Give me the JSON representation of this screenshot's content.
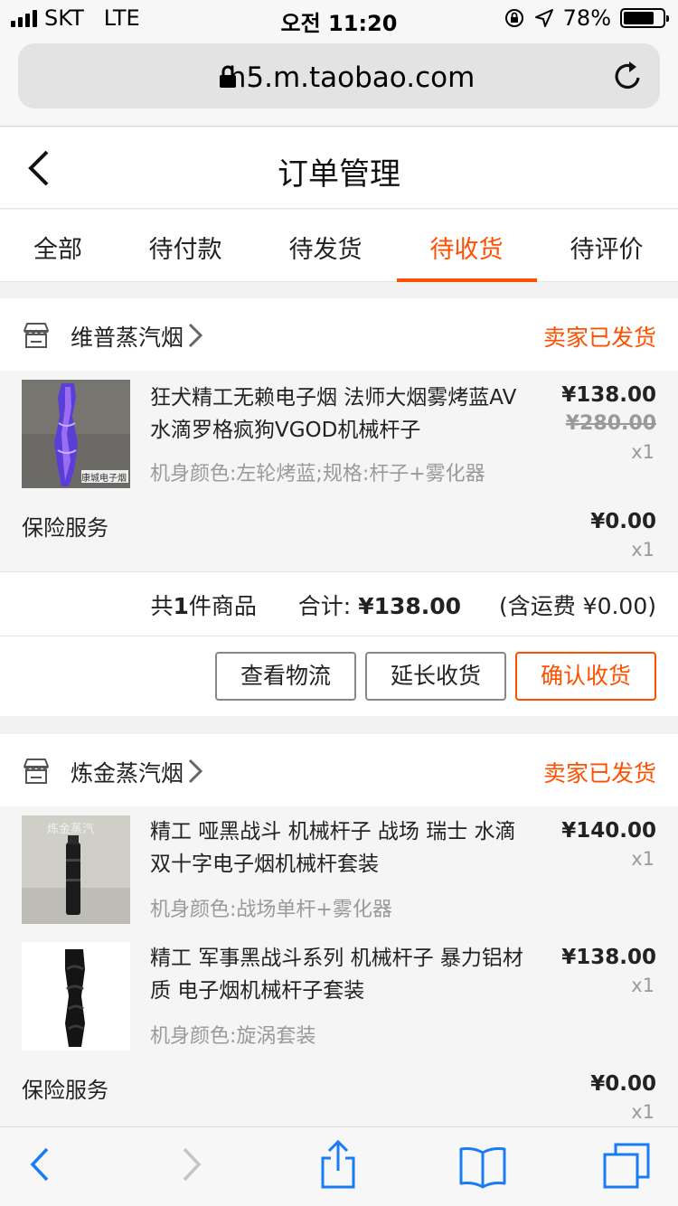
{
  "status_bar": {
    "carrier": "SKT",
    "network": "LTE",
    "time": "오전 11:20",
    "battery": "78%",
    "battery_level": 0.78
  },
  "browser": {
    "url": "h5.m.taobao.com"
  },
  "header": {
    "title": "订单管理"
  },
  "tabs": [
    {
      "label": "全部"
    },
    {
      "label": "待付款"
    },
    {
      "label": "待发货"
    },
    {
      "label": "待收货"
    },
    {
      "label": "待评价"
    }
  ],
  "active_tab": "待收货",
  "accent_color": "#ff5000",
  "orders": [
    {
      "shop": "维普蒸汽烟",
      "status": "卖家已发货",
      "items": [
        {
          "name": "狂犬精工无赖电子烟 法师大烟雾烤蓝AV水滴罗格疯狗VGOD机械杆子",
          "sku": "机身颜色:左轮烤蓝;规格:杆子+雾化器",
          "price": "¥138.00",
          "original_price": "¥280.00",
          "qty": "x1",
          "thumb_caption": "康城电子烟"
        }
      ],
      "insurance": {
        "label": "保险服务",
        "price": "¥0.00",
        "qty": "x1"
      },
      "summary": {
        "count_prefix": "共",
        "count": "1",
        "count_suffix": "件商品",
        "total_label": "合计:",
        "total": "¥138.00",
        "shipping": "(含运费 ¥0.00)"
      },
      "actions": [
        "查看物流",
        "延长收货",
        "确认收货"
      ]
    },
    {
      "shop": "炼金蒸汽烟",
      "status": "卖家已发货",
      "items": [
        {
          "name": "精工 哑黑战斗 机械杆子 战场 瑞士 水滴 双十字电子烟机械杆套装",
          "sku": "机身颜色:战场单杆+雾化器",
          "price": "¥140.00",
          "qty": "x1",
          "thumb_caption": "炼金蒸汽"
        },
        {
          "name": "精工 军事黑战斗系列 机械杆子 暴力铝材质 电子烟机械杆子套装",
          "sku": "机身颜色:旋涡套装",
          "price": "¥138.00",
          "qty": "x1"
        }
      ],
      "insurance": {
        "label": "保险服务",
        "price": "¥0.00",
        "qty": "x1"
      }
    }
  ]
}
